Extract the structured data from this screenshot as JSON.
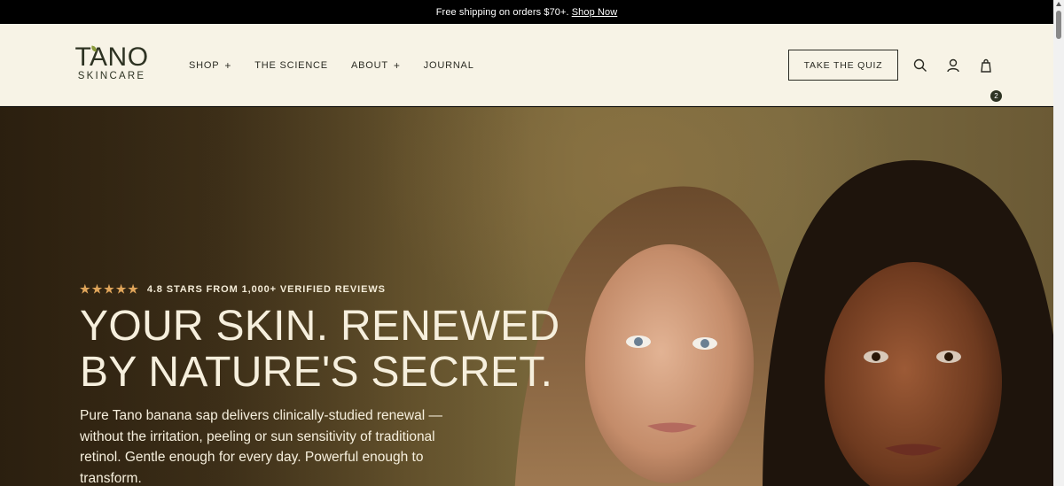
{
  "announcement": {
    "text": "Free shipping on orders $70+.",
    "link": "Shop Now"
  },
  "brand": {
    "name": "TANO",
    "subtitle": "SKINCARE"
  },
  "nav": {
    "items": [
      {
        "label": "SHOP",
        "has_submenu": true,
        "plus": "+"
      },
      {
        "label": "THE SCIENCE",
        "has_submenu": false
      },
      {
        "label": "ABOUT",
        "has_submenu": true,
        "plus": "+"
      },
      {
        "label": "JOURNAL",
        "has_submenu": false
      }
    ]
  },
  "header": {
    "quiz_label": "TAKE THE QUIZ",
    "cart_count": "2",
    "icons": [
      "search-icon",
      "account-icon",
      "cart-bag-icon"
    ]
  },
  "hero": {
    "rating_text": "4.8 STARS FROM 1,000+ VERIFIED REVIEWS",
    "stars": 5,
    "headline_line1": "YOUR SKIN. RENEWED",
    "headline_line2": "BY NATURE'S SECRET.",
    "body": "Pure Tano banana sap delivers clinically-studied renewal — without the irritation, peeling or sun sensitivity of traditional retinol. Gentle enough for every day. Powerful enough to transform."
  },
  "colors": {
    "announcement_bg": "#000000",
    "header_bg": "#f7f3e6",
    "brand_text": "#2e3323",
    "star": "#e0a55a",
    "hero_text": "#f6efdd"
  }
}
